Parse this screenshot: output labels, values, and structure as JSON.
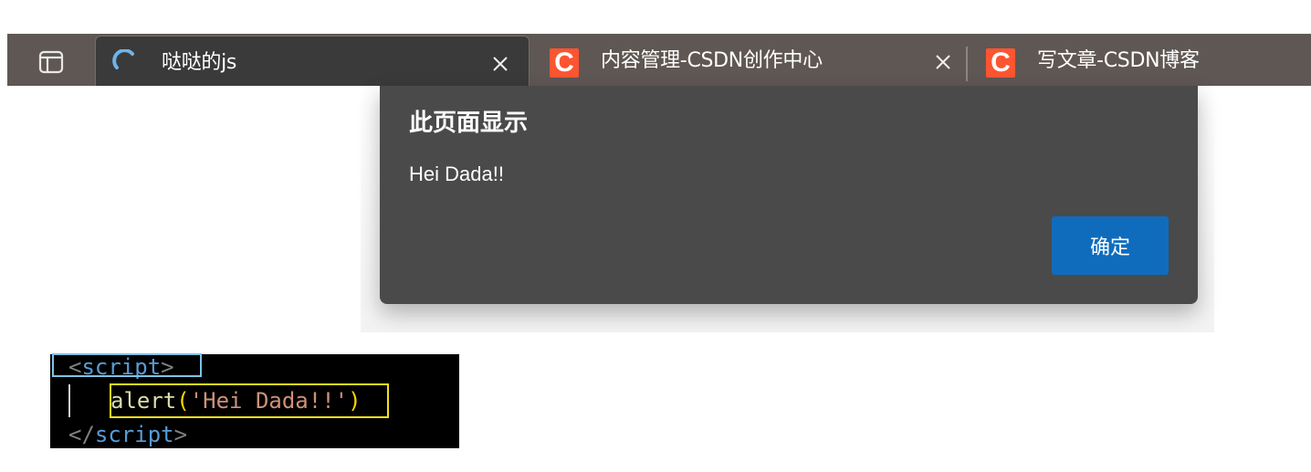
{
  "browser": {
    "tab_actions_icon": "tab-actions-icon",
    "tabs": [
      {
        "title": "哒哒的js",
        "favicon": "loading-spinner-icon",
        "active": true
      },
      {
        "title": "内容管理-CSDN创作中心",
        "favicon": "csdn-icon",
        "favicon_letter": "C",
        "active": false
      },
      {
        "title": "写文章-CSDN博客",
        "favicon": "csdn-icon",
        "favicon_letter": "C",
        "active": false
      }
    ]
  },
  "dialog": {
    "title": "此页面显示",
    "message": "Hei Dada!!",
    "ok_label": "确定"
  },
  "code": {
    "open_lt": "<",
    "open_tag": "script",
    "open_gt": ">",
    "call_fn": "alert",
    "paren_open": "(",
    "string": "'Hei Dada!!'",
    "paren_close": ")",
    "close_lt": "</",
    "close_tag": "script",
    "close_gt": ">"
  },
  "colors": {
    "tabstrip": "#5f5753",
    "active_tab": "#3a3a3a",
    "dialog_bg": "#4a4a4a",
    "ok_button": "#0f6cbd",
    "csdn_brand": "#fc5531",
    "highlight_blue": "#7ec3e6",
    "highlight_yellow": "#f0e21b"
  }
}
